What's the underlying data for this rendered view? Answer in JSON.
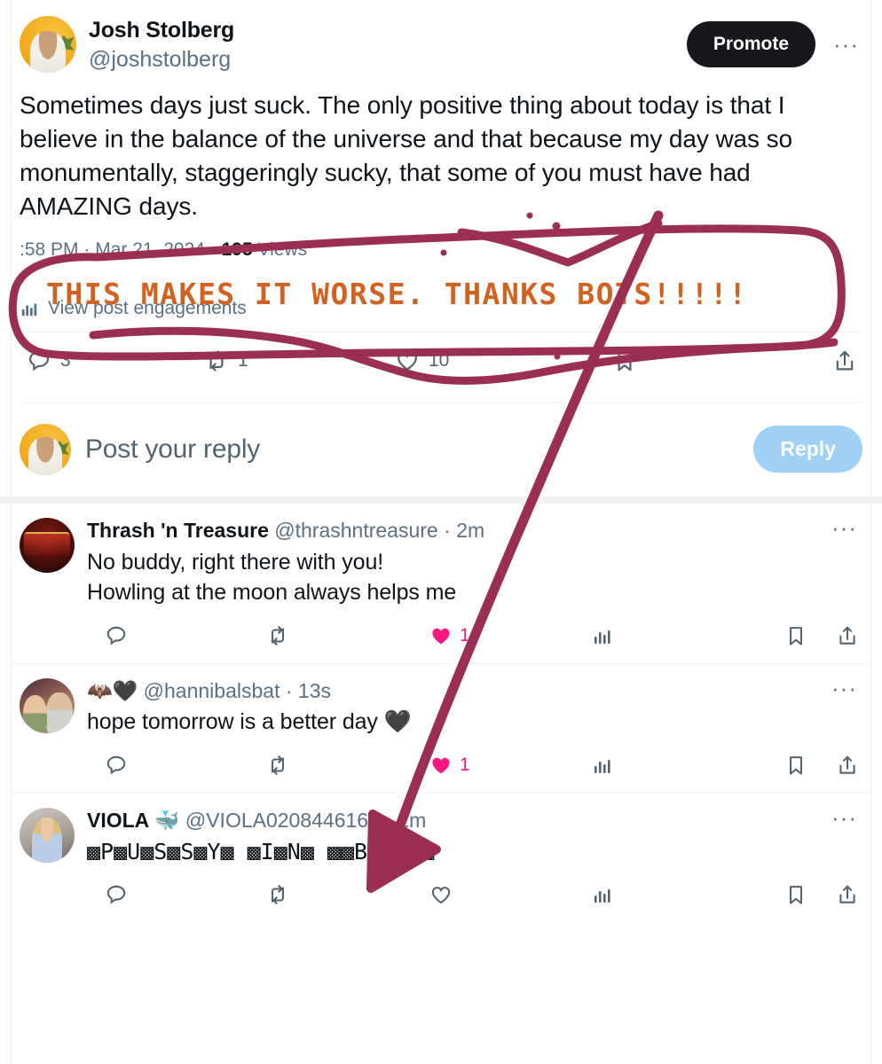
{
  "post": {
    "author_name": "Josh Stolberg",
    "author_handle": "@joshstolberg",
    "promote_label": "Promote",
    "more_label": "···",
    "text": "Sometimes days just suck. The only positive thing about today is that I believe in the balance of the universe and that because my day was so monumentally, staggeringly  sucky, that some of you must have had AMAZING days.",
    "timestamp": ":58 PM",
    "separator": " · ",
    "date": "Mar 21, 2024",
    "views_count": "195",
    "views_label": "Views",
    "engagements_label": "View post engagements",
    "replies_count": "3",
    "reposts_count": "1",
    "likes_count": "10"
  },
  "composer": {
    "placeholder": "Post your reply",
    "reply_button": "Reply"
  },
  "annotation": {
    "text": "THIS MAKES IT WORSE. THANKS BOTS!!!!!",
    "text_color": "#d2621f",
    "ink_color": "#9b2f52"
  },
  "replies": [
    {
      "name": "Thrash 'n Treasure",
      "handle": "@thrashntreasure",
      "sep": " · ",
      "time": "2m",
      "body": "No buddy, right there with you!\nHowling at the moon always helps me",
      "like_count": "1",
      "liked": true,
      "more_label": "···"
    },
    {
      "name": "🦇🖤",
      "handle": "@hannibalsbat",
      "sep": " · ",
      "time": "13s",
      "body": "hope tomorrow is a better day 🖤",
      "like_count": "1",
      "liked": true,
      "more_label": "···"
    },
    {
      "name": "VIOLA 🐳",
      "handle": "@VIOLA0208446168",
      "sep": " · ",
      "time": "2m",
      "body": "▩P▩U▩S▩S▩Y▩ ▩I▩N▩ ▩▩B▩I▩O▩",
      "like_count": "",
      "liked": false,
      "more_label": "···"
    }
  ],
  "icons": {
    "reply": "reply-icon",
    "repost": "repost-icon",
    "like": "heart-icon",
    "views": "analytics-icon",
    "bookmark": "bookmark-icon",
    "share": "share-icon"
  }
}
